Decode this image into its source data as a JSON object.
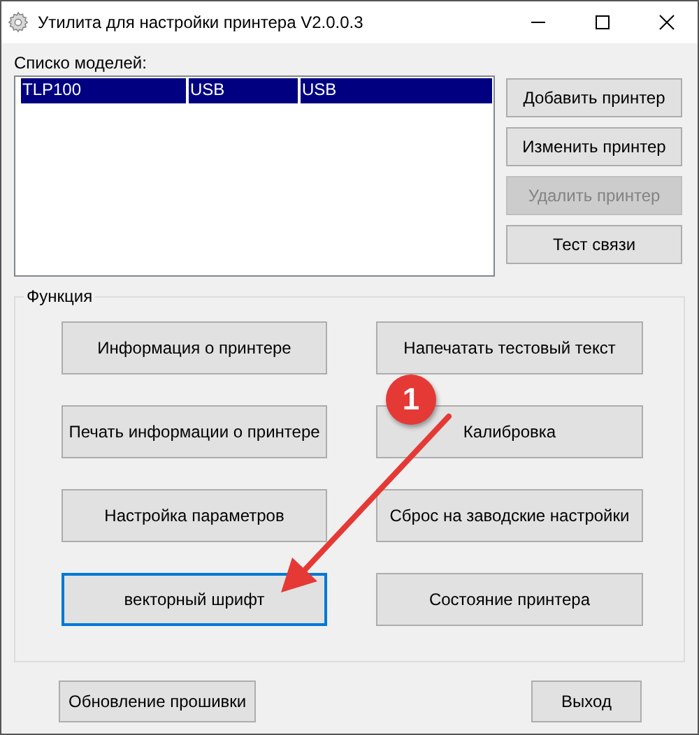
{
  "window": {
    "title": "Утилита для настройки принтера  V2.0.0.3"
  },
  "models": {
    "label": "Списко моделей:",
    "rows": [
      {
        "cells": [
          "TLP100",
          "USB",
          "USB"
        ],
        "selected": true
      }
    ]
  },
  "side_buttons": [
    {
      "label": "Добавить принтер",
      "disabled": false
    },
    {
      "label": "Изменить принтер",
      "disabled": false
    },
    {
      "label": "Удалить принтер",
      "disabled": true
    },
    {
      "label": "Тест связи",
      "disabled": false
    }
  ],
  "function_group": {
    "title": "Функция",
    "buttons": [
      {
        "label": "Информация о принтере",
        "focused": false
      },
      {
        "label": "Напечатать тестовый текст",
        "focused": false
      },
      {
        "label": "Печать информации о принтере",
        "focused": false
      },
      {
        "label": "Калибровка",
        "focused": false
      },
      {
        "label": "Настройка параметров",
        "focused": false
      },
      {
        "label": "Сброс на заводские настройки",
        "focused": false
      },
      {
        "label": "векторный шрифт",
        "focused": true
      },
      {
        "label": "Состояние принтера",
        "focused": false
      }
    ]
  },
  "bottom_buttons": [
    "Обновление прошивки",
    "Выход"
  ],
  "annotation": {
    "badge": "1"
  }
}
